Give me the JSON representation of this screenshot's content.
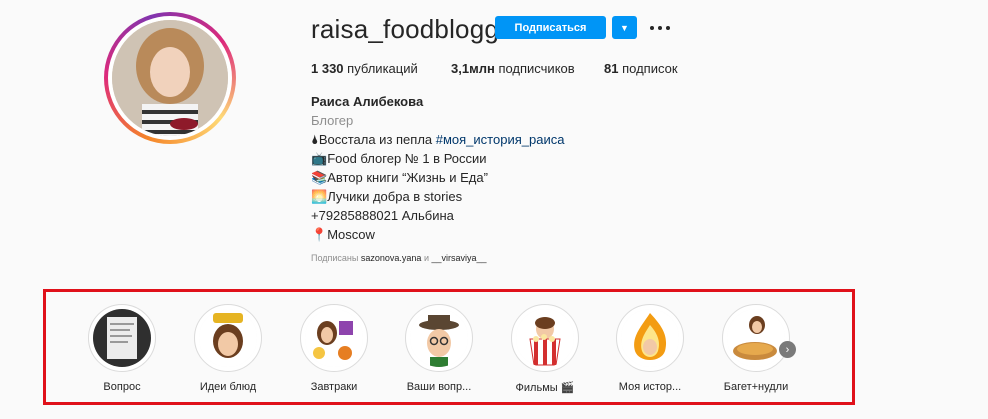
{
  "profile": {
    "username": "raisa_foodblogger",
    "follow_label": "Подписаться",
    "dropdown_glyph": "▼",
    "stats": {
      "posts_count": "1 330",
      "posts_label": "публикаций",
      "followers_count": "3,1млн",
      "followers_label": "подписчиков",
      "following_count": "81",
      "following_label": "подписок"
    },
    "full_name": "Раиса Алибекова",
    "category": "Блогер",
    "bio_line1_prefix": "Восстала из пепла ",
    "bio_line1_tag": "#моя_история_раиса",
    "bio_line2": "Food блогер № 1 в России",
    "bio_line3": "Автор книги “Жизнь и Еда”",
    "bio_line4": "Лучики добра в stories",
    "bio_line5": "+79285888021 Альбина",
    "bio_line6": "Moscow",
    "followed_by_label": "Подписаны",
    "followed_by_user1": "sazonova.yana",
    "followed_by_and": "и",
    "followed_by_user2": "__virsaviya__"
  },
  "highlights": [
    {
      "label": "Вопрос"
    },
    {
      "label": "Идеи блюд"
    },
    {
      "label": "Завтраки"
    },
    {
      "label": "Ваши вопр..."
    },
    {
      "label": "Фильмы 🎬"
    },
    {
      "label": "Моя истор..."
    },
    {
      "label": "Багет+нудли"
    }
  ],
  "colors": {
    "accent": "#0095f6",
    "highlight_frame": "#e0111a",
    "hashtag": "#00376b"
  }
}
